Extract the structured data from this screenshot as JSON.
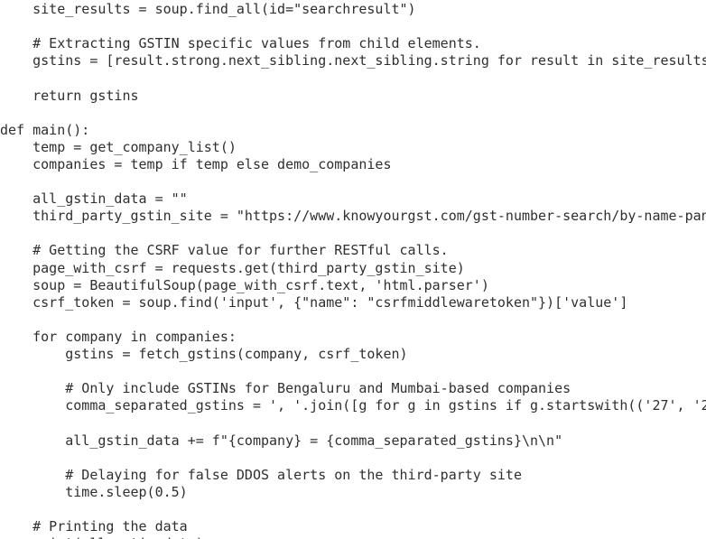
{
  "editor": {
    "lines": [
      "    site_results = soup.find_all(id=\"searchresult\")",
      "",
      "    # Extracting GSTIN specific values from child elements.",
      "    gstins = [result.strong.next_sibling.next_sibling.string for result in site_results",
      "",
      "    return gstins",
      "",
      "def main():",
      "    temp = get_company_list()",
      "    companies = temp if temp else demo_companies",
      "",
      "    all_gstin_data = \"\"",
      "    third_party_gstin_site = \"https://www.knowyourgst.com/gst-number-search/by-name-pan",
      "",
      "    # Getting the CSRF value for further RESTful calls.",
      "    page_with_csrf = requests.get(third_party_gstin_site)",
      "    soup = BeautifulSoup(page_with_csrf.text, 'html.parser')",
      "    csrf_token = soup.find('input', {\"name\": \"csrfmiddlewaretoken\"})['value']",
      "",
      "    for company in companies:",
      "        gstins = fetch_gstins(company, csrf_token)",
      "",
      "        # Only include GSTINs for Bengaluru and Mumbai-based companies",
      "        comma_separated_gstins = ', '.join([g for g in gstins if g.startswith(('27', '2",
      "",
      "        all_gstin_data += f\"{company} = {comma_separated_gstins}\\n\\n\"",
      "",
      "        # Delaying for false DDOS alerts on the third-party site",
      "        time.sleep(0.5)",
      "",
      "    # Printing the data",
      "    print(all_gstin_data)"
    ]
  }
}
